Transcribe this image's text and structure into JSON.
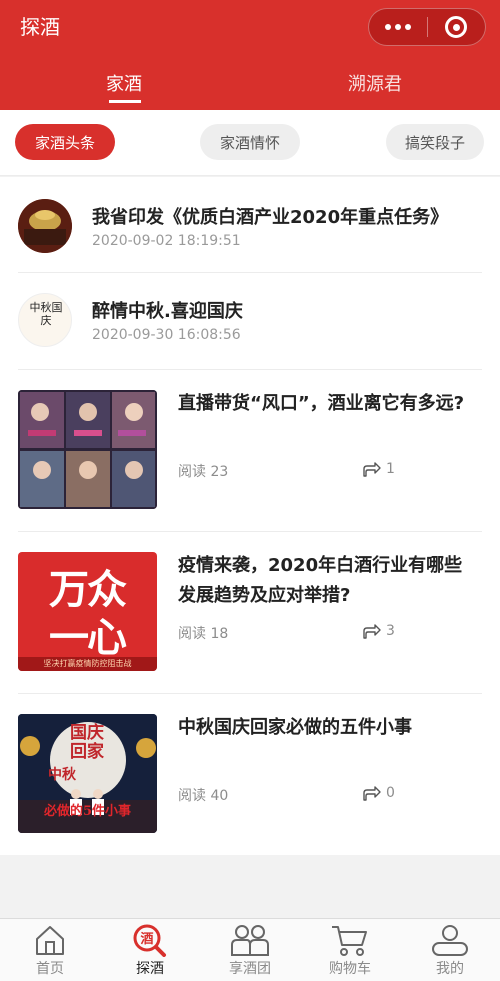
{
  "header": {
    "title": "探酒",
    "tabs": [
      "家酒",
      "溯源君"
    ],
    "active_tab": 0
  },
  "subtabs": [
    "家酒头条",
    "家酒情怀",
    "搞笑段子"
  ],
  "articles_small": [
    {
      "title": "我省印发《优质白酒产业2020年重点任务》",
      "date": "2020-09-02 18:19:51"
    },
    {
      "title": "醉情中秋.喜迎国庆",
      "date": "2020-09-30 16:08:56"
    }
  ],
  "articles_big": [
    {
      "title": "直播带货“风口”，酒业离它有多远?",
      "read_label": "阅读 23",
      "shares": "1"
    },
    {
      "title": "疫情来袭，2020年白酒行业有哪些发展趋势及应对举措?",
      "read_label": "阅读 18",
      "shares": "3",
      "thumb_text": "万众一心",
      "thumb_caption": "坚决打赢疫情防控阻击战"
    },
    {
      "title": "中秋国庆回家必做的五件小事",
      "read_label": "阅读 40",
      "shares": "0",
      "thumb_text": "国庆回家",
      "thumb_text2": "中秋",
      "thumb_caption": "必做的5件小事"
    }
  ],
  "avatar2_text": "中秋国庆",
  "nav": [
    {
      "label": "首页",
      "icon": "home-icon"
    },
    {
      "label": "探酒",
      "icon": "wine-search-icon",
      "badge": "酒"
    },
    {
      "label": "享酒团",
      "icon": "group-icon"
    },
    {
      "label": "购物车",
      "icon": "cart-icon"
    },
    {
      "label": "我的",
      "icon": "user-icon"
    }
  ],
  "colors": {
    "accent": "#d8302c",
    "capsule": "#b91f1c",
    "muted": "#9a9a9a"
  }
}
